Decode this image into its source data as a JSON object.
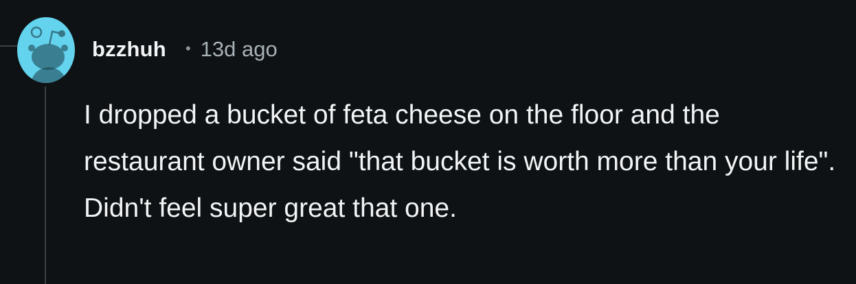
{
  "comment": {
    "author": "bzzhuh",
    "separator": "•",
    "timestamp": "13d ago",
    "avatar_icon": "snoo-avatar-icon",
    "avatar_color": "#63d3ee",
    "body": "I dropped a bucket of feta cheese on the floor and the restaurant owner said \"that bucket is worth more than your life\". Didn't feel super great that one."
  },
  "colors": {
    "background": "#0f1214",
    "text_primary": "#f2f4f5",
    "text_secondary": "#a7b1b6",
    "thread_line": "#3a4044"
  }
}
